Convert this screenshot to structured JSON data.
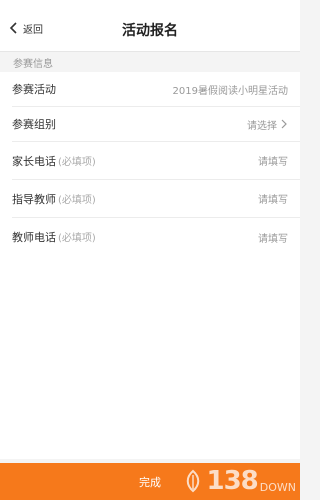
{
  "header": {
    "back_label": "返回",
    "title": "活动报名"
  },
  "form": {
    "section_label": "参赛信息",
    "rows": [
      {
        "label": "参赛活动",
        "required": "",
        "value": "2019暑假阅读小明星活动"
      },
      {
        "label": "参赛组别",
        "required": "",
        "value": "请选择"
      },
      {
        "label": "家长电话",
        "required": "(必填项)",
        "value": "请填写"
      },
      {
        "label": "指导教师",
        "required": "(必填项)",
        "value": "请填写"
      },
      {
        "label": "教师电话",
        "required": "(必填项)",
        "value": "请填写"
      }
    ]
  },
  "footer": {
    "submit_label": "完成"
  },
  "watermark": {
    "number": "138",
    "suffix": "DOWN"
  },
  "colors": {
    "accent": "#f6791b",
    "background": "#f4f4f4"
  }
}
